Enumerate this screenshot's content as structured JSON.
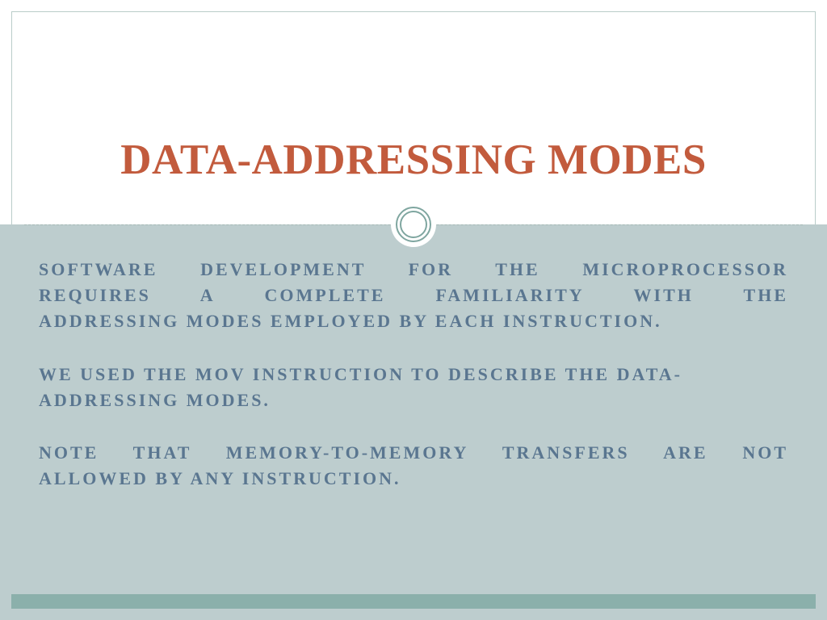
{
  "title": "DATA-ADDRESSING MODES",
  "paragraphs": {
    "p1_l1": "SOFTWARE DEVELOPMENT FOR THE MICROPROCESSOR",
    "p1_l2": "REQUIRES A COMPLETE FAMILIARITY WITH THE",
    "p1_l3": "ADDRESSING MODES EMPLOYED BY EACH INSTRUCTION.",
    "p2": "WE USED THE MOV INSTRUCTION TO DESCRIBE THE DATA-ADDRESSING MODES.",
    "p3_l1": "NOTE THAT MEMORY-TO-MEMORY TRANSFERS ARE NOT",
    "p3_l2": "ALLOWED BY ANY INSTRUCTION."
  },
  "colors": {
    "title": "#c25b3d",
    "body_bg": "#bdcdce",
    "text": "#5a7690",
    "accent": "#8bb0ab",
    "border": "#b9ccc9"
  }
}
